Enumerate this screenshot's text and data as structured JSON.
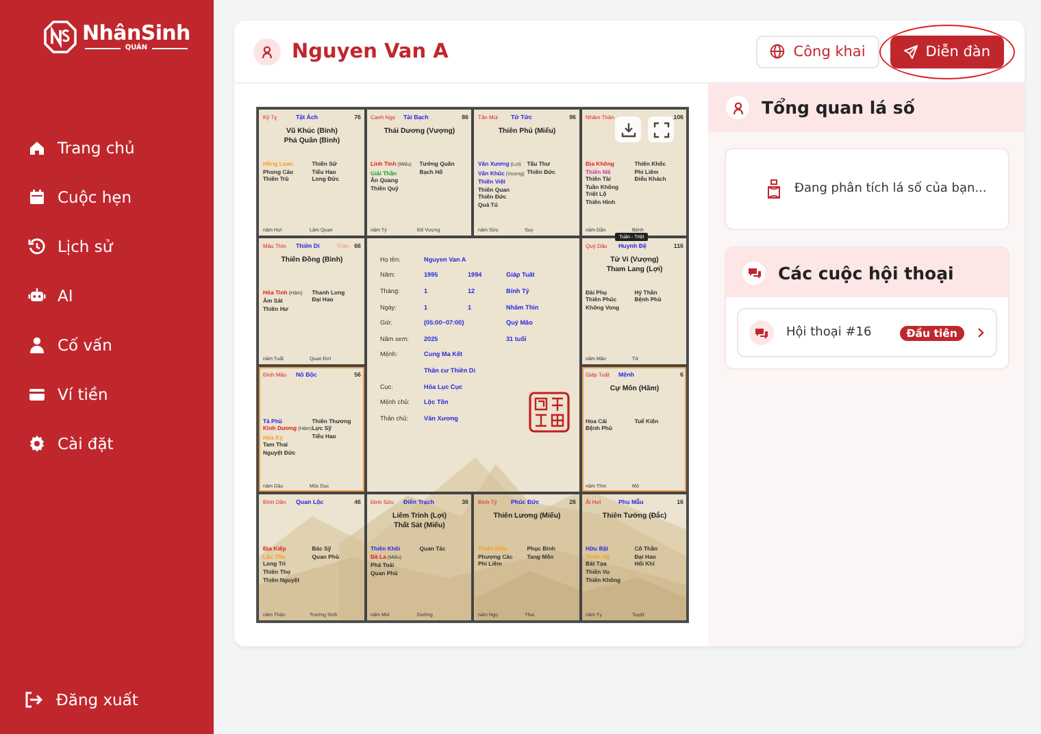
{
  "sidebar": {
    "logo": {
      "name": "NhânSinh",
      "sub": "QUÁN"
    },
    "items": [
      {
        "label": "Trang chủ",
        "selected": false
      },
      {
        "label": "Cuộc hẹn",
        "selected": false
      },
      {
        "label": "Lịch sử",
        "selected": false
      },
      {
        "label": "AI",
        "selected": false
      },
      {
        "label": "Cố vấn",
        "selected": false
      },
      {
        "label": "Ví tiền",
        "selected": false
      },
      {
        "label": "Cài đặt",
        "selected": false
      }
    ],
    "logout": "Đăng xuất"
  },
  "header": {
    "name": "Nguyen Van A",
    "buttons": [
      {
        "label": "Công khai",
        "kind": "outline",
        "circled": false
      },
      {
        "label": "Diễn đàn",
        "kind": "primary",
        "circled": true
      }
    ]
  },
  "chart": {
    "tooltip": "Tuần - Triệt",
    "palaces": [
      {
        "stem": "Kỷ Tỵ",
        "name": "Tật Ách",
        "number": "76",
        "highlighted": false,
        "main": [
          "Vũ Khúc (Bình)",
          "Phá Quân (Bình)"
        ],
        "left": [
          {
            "name": "Hồng Loan",
            "color": "#f0a020"
          },
          {
            "name": "Phong Cáo",
            "color": "#333333"
          },
          {
            "name": "Thiên Trù",
            "color": "#333333"
          }
        ],
        "right": [
          {
            "name": "Thiên Sứ",
            "color": "#333333"
          },
          {
            "name": "Tiểu Hao",
            "color": "#333333"
          },
          {
            "name": "Long Đức",
            "color": "#333333"
          }
        ],
        "footer": [
          "năm Hợi",
          "Lâm Quan"
        ]
      },
      {
        "stem": "Canh Ngọ",
        "name": "Tài Bạch",
        "number": "86",
        "highlighted": false,
        "main": [
          "Thái Dương (Vượng)"
        ],
        "left": [
          {
            "name": "Linh Tinh",
            "note": "(Miếu)",
            "color": "#e02020"
          },
          {
            "name": "Giải Thần",
            "color": "#20a030"
          },
          {
            "name": "Ân Quang",
            "color": "#333333"
          },
          {
            "name": "Thiên Quý",
            "color": "#333333"
          }
        ],
        "right": [
          {
            "name": "Tướng Quân",
            "color": "#333333"
          },
          {
            "name": "Bạch Hổ",
            "color": "#333333"
          }
        ],
        "footer": [
          "năm Tý",
          "Đế Vượng"
        ]
      },
      {
        "stem": "Tân Mùi",
        "name": "Tử Tức",
        "number": "96",
        "highlighted": false,
        "main": [
          "Thiên Phủ (Miếu)"
        ],
        "left": [
          {
            "name": "Văn Xương",
            "note": "(Lợi)",
            "color": "#2a2ae0"
          },
          {
            "name": "Văn Khúc",
            "note": "(Vượng)",
            "color": "#2a2ae0"
          },
          {
            "name": "Thiên Việt",
            "color": "#2a2ae0"
          },
          {
            "name": "Thiên Quan",
            "color": "#333333"
          },
          {
            "name": "Thiên Đức",
            "color": "#333333"
          },
          {
            "name": "Quả Tú",
            "color": "#333333"
          }
        ],
        "right": [
          {
            "name": "Tấu Thư",
            "color": "#333333"
          },
          {
            "name": "Thiên Đức",
            "color": "#333333"
          }
        ],
        "footer": [
          "năm Sửu",
          "Suy"
        ]
      },
      {
        "stem": "Nhâm Thân",
        "number": "106",
        "highlighted": false,
        "left": [
          {
            "name": "Địa Không",
            "color": "#e02020"
          },
          {
            "name": "Thiên Mã",
            "color": "#c040a0"
          },
          {
            "name": "Thiên Tài",
            "color": "#333333"
          },
          {
            "name": "Tuần Không",
            "color": "#333333"
          },
          {
            "name": "Triệt Lộ",
            "color": "#333333"
          },
          {
            "name": "Thiên Hình",
            "color": "#333333"
          }
        ],
        "right": [
          {
            "name": "Thiên Khốc",
            "color": "#333333"
          },
          {
            "name": "Phi Liêm",
            "color": "#333333"
          },
          {
            "name": "Điếu Khách",
            "color": "#333333"
          }
        ],
        "footer": [
          "năm Dần",
          "Bệnh"
        ]
      },
      {
        "stem": "Mậu Thìn",
        "name": "Thiên Di",
        "tag": "Thân",
        "number": "66",
        "highlighted": false,
        "main": [
          "Thiên Đồng (Bình)"
        ],
        "left": [
          {
            "name": "Hỏa Tinh",
            "note": "(Hãm)",
            "color": "#e02020"
          },
          {
            "name": "Âm Sát",
            "color": "#333333"
          },
          {
            "name": "Thiên Hư",
            "color": "#333333"
          }
        ],
        "right": [
          {
            "name": "Thanh Long",
            "color": "#333333"
          },
          {
            "name": "Đại Hao",
            "color": "#333333"
          }
        ],
        "footer": [
          "năm Tuất",
          "Quan Đới"
        ]
      },
      {
        "stem": "Quý Dậu",
        "name": "Huynh Đệ",
        "number": "116",
        "highlighted": false,
        "main": [
          "Tử Vi (Vượng)",
          "Tham Lang (Lợi)"
        ],
        "left": [
          {
            "name": "Đài Phụ",
            "color": "#333333"
          },
          {
            "name": "Thiên Phúc",
            "color": "#333333"
          },
          {
            "name": "Không Vong",
            "color": "#333333"
          }
        ],
        "right": [
          {
            "name": "Hỷ Thần",
            "color": "#333333"
          },
          {
            "name": "Bệnh Phù",
            "color": "#333333"
          }
        ],
        "footer": [
          "năm Mão",
          "Tử"
        ]
      },
      {
        "stem": "Đinh Mão",
        "name": "Nô Bộc",
        "number": "56",
        "highlighted": true,
        "left": [
          {
            "name": "Tả Phù",
            "color": "#2a2ae0"
          },
          {
            "name": "Kình Dương",
            "note": "(Hãm)",
            "color": "#e02020"
          },
          {
            "name": "Hóa Kỵ",
            "color": "#f0a020"
          },
          {
            "name": "Tam Thai",
            "color": "#333333"
          },
          {
            "name": "Nguyệt Đức",
            "color": "#333333"
          }
        ],
        "right": [
          {
            "name": "Thiên Thương",
            "color": "#333333"
          },
          {
            "name": "Lực Sỹ",
            "color": "#333333"
          },
          {
            "name": "Tiểu Hao",
            "color": "#333333"
          }
        ],
        "footer": [
          "năm Dậu",
          "Mộc Dục"
        ]
      },
      {
        "stem": "Giáp Tuất",
        "name": "Mệnh",
        "number": "6",
        "highlighted": true,
        "main": [
          "Cự Môn (Hãm)"
        ],
        "left": [
          {
            "name": "Hoa Cái",
            "color": "#333333"
          },
          {
            "name": "Bệnh Phù",
            "color": "#333333"
          }
        ],
        "right": [
          {
            "name": "Tuế Kiện",
            "color": "#333333"
          }
        ],
        "footer": [
          "năm Thìn",
          "Mộ"
        ]
      },
      {
        "stem": "Bính Dần",
        "name": "Quan Lộc",
        "number": "46",
        "highlighted": false,
        "left": [
          {
            "name": "Địa Kiếp",
            "color": "#e02020"
          },
          {
            "name": "Lộc Tồn",
            "color": "#f0a020"
          },
          {
            "name": "Long Trì",
            "color": "#333333"
          },
          {
            "name": "Thiên Thọ",
            "color": "#333333"
          },
          {
            "name": "Thiên Nguyệt",
            "color": "#333333"
          }
        ],
        "right": [
          {
            "name": "Bác Sỹ",
            "color": "#333333"
          },
          {
            "name": "Quan Phù",
            "color": "#333333"
          }
        ],
        "footer": [
          "năm Thân",
          "Trường Sinh"
        ]
      },
      {
        "stem": "Đinh Sửu",
        "name": "Điền Trạch",
        "number": "36",
        "highlighted": false,
        "main": [
          "Liêm Trinh (Lợi)",
          "Thất Sát (Miếu)"
        ],
        "left": [
          {
            "name": "Thiên Khôi",
            "color": "#2a2ae0"
          },
          {
            "name": "Đà La",
            "note": "(Miếu)",
            "color": "#e02020"
          },
          {
            "name": "Phá Toái",
            "color": "#333333"
          },
          {
            "name": "Quan Phù",
            "color": "#333333"
          }
        ],
        "right": [
          {
            "name": "Quan Tác",
            "color": "#333333"
          }
        ],
        "footer": [
          "năm Mùi",
          "Dưỡng"
        ]
      },
      {
        "stem": "Bính Tý",
        "name": "Phúc Đức",
        "number": "26",
        "highlighted": false,
        "main": [
          "Thiên Lương (Miếu)"
        ],
        "left": [
          {
            "name": "Thiên Diêu",
            "color": "#f0a020"
          },
          {
            "name": "Phượng Các",
            "color": "#333333"
          },
          {
            "name": "Phi Liêm",
            "color": "#333333"
          }
        ],
        "right": [
          {
            "name": "Phục Binh",
            "color": "#333333"
          },
          {
            "name": "Tang Môn",
            "color": "#333333"
          }
        ],
        "footer": [
          "năm Ngọ",
          "Thai"
        ]
      },
      {
        "stem": "Ất Hợi",
        "name": "Phụ Mẫu",
        "number": "16",
        "highlighted": false,
        "main": [
          "Thiên Tướng (Đắc)"
        ],
        "left": [
          {
            "name": "Hữu Bật",
            "color": "#2a2ae0"
          },
          {
            "name": "Thiên Hỷ",
            "color": "#f0a020"
          },
          {
            "name": "Bát Tọa",
            "color": "#333333"
          },
          {
            "name": "Thiên Vu",
            "color": "#333333"
          },
          {
            "name": "Thiên Không",
            "color": "#333333"
          }
        ],
        "right": [
          {
            "name": "Cô Thần",
            "color": "#333333"
          },
          {
            "name": "Đại Hao",
            "color": "#333333"
          },
          {
            "name": "Hối Khí",
            "color": "#333333"
          }
        ],
        "footer": [
          "năm Tỵ",
          "Tuyệt"
        ]
      }
    ],
    "center": [
      {
        "label": "Họ tên:",
        "values": [
          "Nguyen Van A"
        ]
      },
      {
        "label": "Năm:",
        "values": [
          "1995",
          "1994",
          "Giáp Tuất"
        ]
      },
      {
        "label": "Tháng:",
        "values": [
          "1",
          "12",
          "Bính Tý"
        ]
      },
      {
        "label": "Ngày:",
        "values": [
          "1",
          "1",
          "Nhâm Thìn"
        ]
      },
      {
        "label": "Giờ:",
        "values": [
          "(05:00~07:00)",
          "Quý Mão"
        ]
      },
      {
        "label": "Năm xem:",
        "values": [
          "2025",
          "31 tuổi"
        ]
      },
      {
        "label": "Mệnh:",
        "values": [
          "Cung Ma Kết"
        ]
      },
      {
        "values": [
          "Thân cư Thiên Di"
        ]
      },
      {
        "label": "Cục:",
        "values": [
          "Hỏa Lục Cục"
        ]
      },
      {
        "label": "Mệnh chủ:",
        "values": [
          "Lộc Tồn"
        ]
      },
      {
        "label": "Thân chủ:",
        "values": [
          "Văn Xương"
        ]
      }
    ]
  },
  "overview": {
    "title": "Tổng quan lá số",
    "status": "Đang phân tích lá số của bạn..."
  },
  "conversations": {
    "title": "Các cuộc hội thoại",
    "items": [
      {
        "title": "Hội thoại #16",
        "badge": "Đầu tiên"
      }
    ]
  }
}
